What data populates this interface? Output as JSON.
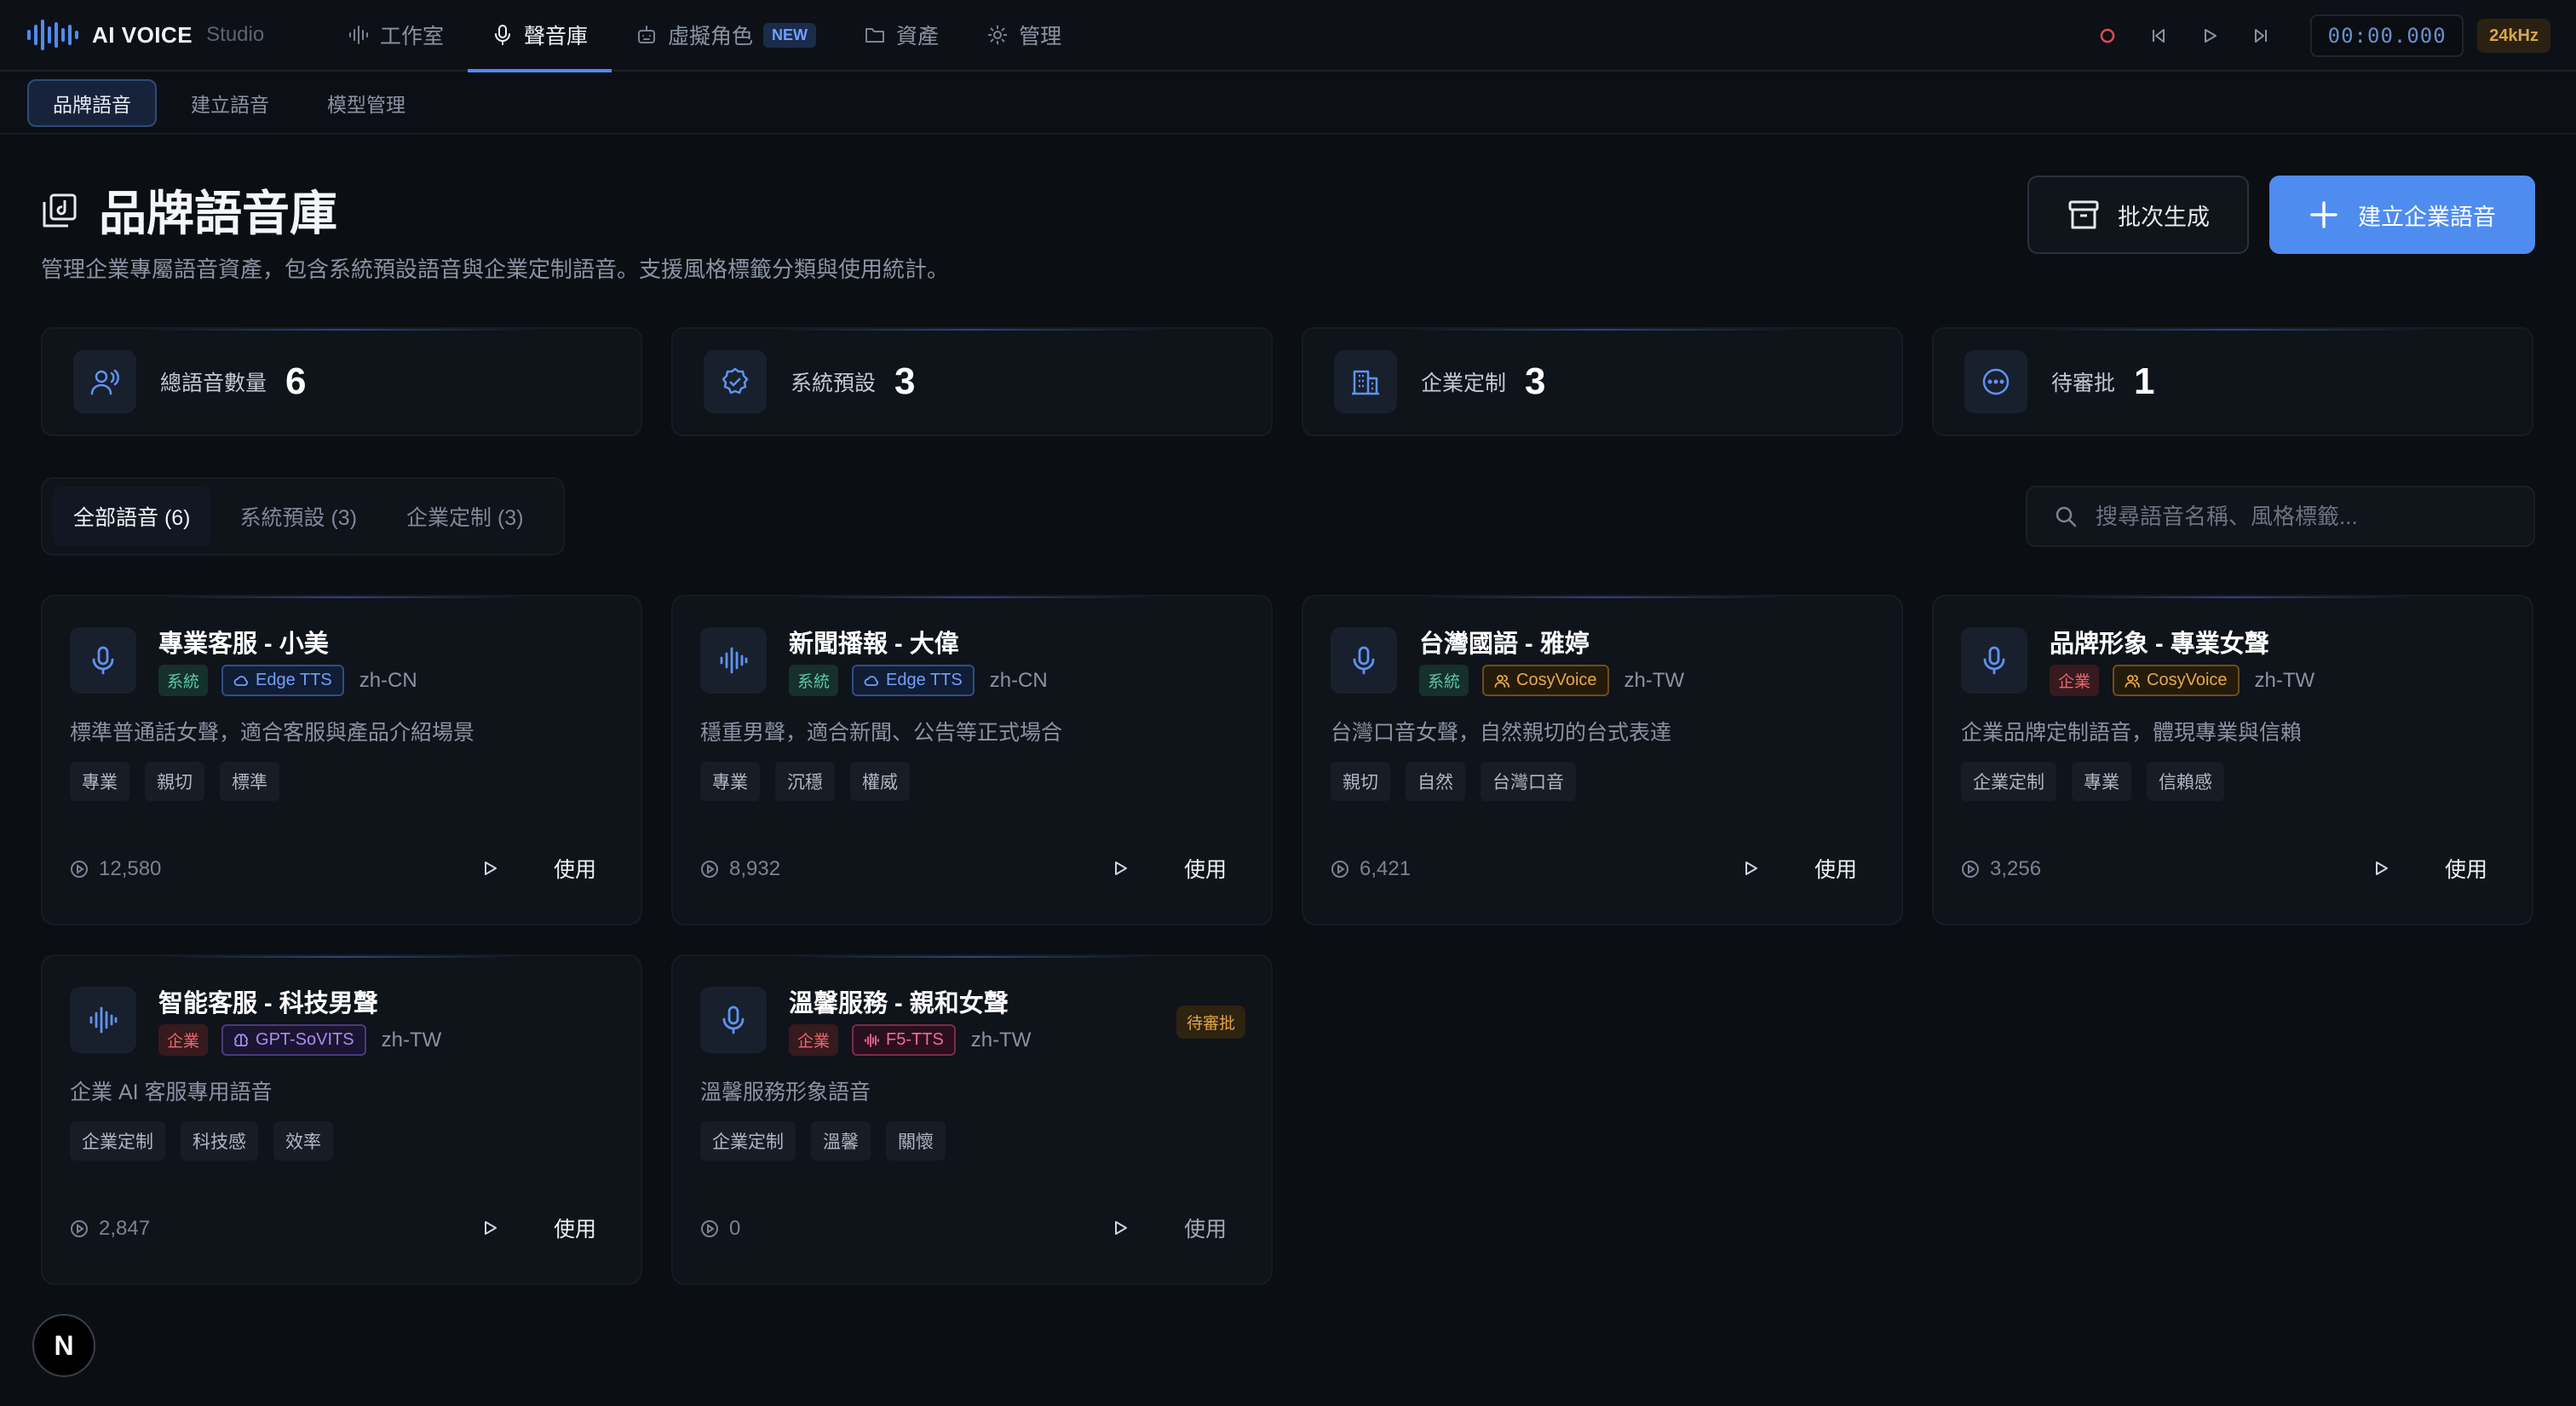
{
  "app": {
    "brand": "AI VOICE",
    "brand_sub": "Studio"
  },
  "nav": [
    {
      "label": "工作室",
      "icon": "waveform-icon"
    },
    {
      "label": "聲音庫",
      "icon": "mic-icon",
      "active": true
    },
    {
      "label": "虛擬角色",
      "icon": "robot-icon",
      "badge": "NEW"
    },
    {
      "label": "資產",
      "icon": "folder-icon"
    },
    {
      "label": "管理",
      "icon": "gear-icon"
    }
  ],
  "transport": {
    "timecode": "00:00.000",
    "rate": "24kHz"
  },
  "subtabs": [
    "品牌語音",
    "建立語音",
    "模型管理"
  ],
  "header": {
    "title": "品牌語音庫",
    "desc": "管理企業專屬語音資產，包含系統預設語音與企業定制語音。支援風格標籤分類與使用統計。",
    "batch_label": "批次生成",
    "create_label": "建立企業語音"
  },
  "stats": [
    {
      "label": "總語音數量",
      "value": "6"
    },
    {
      "label": "系統預設",
      "value": "3"
    },
    {
      "label": "企業定制",
      "value": "3"
    },
    {
      "label": "待審批",
      "value": "1"
    }
  ],
  "filters": [
    "全部語音 (6)",
    "系統預設 (3)",
    "企業定制 (3)"
  ],
  "search": {
    "placeholder": "搜尋語音名稱、風格標籤..."
  },
  "cards": [
    {
      "name": "專業客服 - 小美",
      "type": "系統",
      "engine": "Edge TTS",
      "locale": "zh-CN",
      "desc": "標準普通話女聲，適合客服與產品介紹場景",
      "tags": [
        "專業",
        "親切",
        "標準"
      ],
      "count": "12,580",
      "use": "使用",
      "icon": "mic-icon"
    },
    {
      "name": "新聞播報 - 大偉",
      "type": "系統",
      "engine": "Edge TTS",
      "locale": "zh-CN",
      "desc": "穩重男聲，適合新聞、公告等正式場合",
      "tags": [
        "專業",
        "沉穩",
        "權威"
      ],
      "count": "8,932",
      "use": "使用",
      "icon": "waveform-icon"
    },
    {
      "name": "台灣國語 - 雅婷",
      "type": "系統",
      "engine": "CosyVoice",
      "locale": "zh-TW",
      "desc": "台灣口音女聲，自然親切的台式表達",
      "tags": [
        "親切",
        "自然",
        "台灣口音"
      ],
      "count": "6,421",
      "use": "使用",
      "icon": "mic-icon"
    },
    {
      "name": "品牌形象 - 專業女聲",
      "type": "企業",
      "engine": "CosyVoice",
      "locale": "zh-TW",
      "desc": "企業品牌定制語音，體現專業與信賴",
      "tags": [
        "企業定制",
        "專業",
        "信賴感"
      ],
      "count": "3,256",
      "use": "使用",
      "icon": "mic-icon"
    },
    {
      "name": "智能客服 - 科技男聲",
      "type": "企業",
      "engine": "GPT-SoVITS",
      "locale": "zh-TW",
      "desc": "企業 AI 客服專用語音",
      "tags": [
        "企業定制",
        "科技感",
        "效率"
      ],
      "count": "2,847",
      "use": "使用",
      "icon": "waveform-icon"
    },
    {
      "name": "溫馨服務 - 親和女聲",
      "type": "企業",
      "engine": "F5-TTS",
      "locale": "zh-TW",
      "desc": "溫馨服務形象語音",
      "tags": [
        "企業定制",
        "溫馨",
        "關懷"
      ],
      "count": "0",
      "use": "使用",
      "icon": "mic-icon",
      "pending": "待審批"
    }
  ],
  "corner": {
    "label": "N"
  }
}
